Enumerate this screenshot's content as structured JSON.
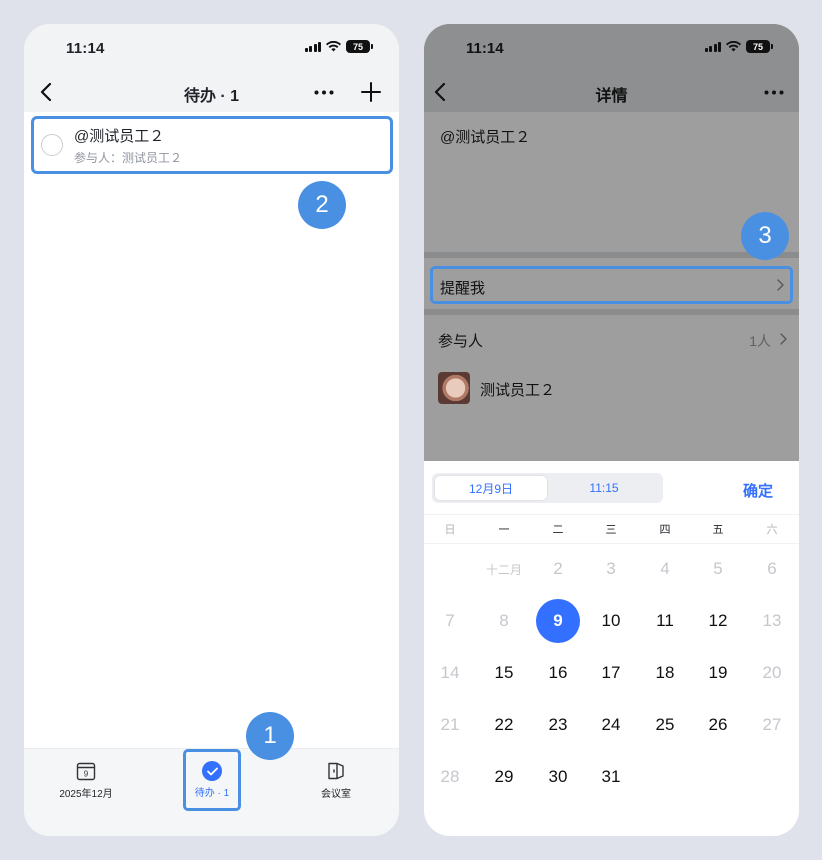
{
  "left": {
    "status": {
      "time": "11:14",
      "battery": "75"
    },
    "nav": {
      "title": "待办 · 1"
    },
    "todo": {
      "title": "@测试员工２",
      "participants": "参与人：测试员工２"
    },
    "tabs": [
      {
        "label": "2025年12月",
        "icon": "calendar-icon",
        "day": "9"
      },
      {
        "label": "待办 · 1",
        "icon": "check-circle-icon"
      },
      {
        "label": "会议室",
        "icon": "meeting-room-icon"
      }
    ],
    "badges": [
      "1",
      "2"
    ]
  },
  "right": {
    "status": {
      "time": "11:14",
      "battery": "75"
    },
    "nav": {
      "title": "详情"
    },
    "content_title": "@测试员工２",
    "remind_label": "提醒我",
    "participants_label": "参与人",
    "participants_count": "1人",
    "participant_name": "测试员工２",
    "badge": "3",
    "picker": {
      "date_tab": "12月9日",
      "time_tab": "11:15",
      "confirm": "确定",
      "weekdays": [
        "日",
        "一",
        "二",
        "三",
        "四",
        "五",
        "六"
      ],
      "rows": [
        [
          "",
          "十二月",
          "2",
          "3",
          "4",
          "5",
          "6"
        ],
        [
          "7",
          "8",
          "9",
          "10",
          "11",
          "12",
          "13"
        ],
        [
          "14",
          "15",
          "16",
          "17",
          "18",
          "19",
          "20"
        ],
        [
          "21",
          "22",
          "23",
          "24",
          "25",
          "26",
          "27"
        ],
        [
          "28",
          "29",
          "30",
          "31",
          "",
          "",
          ""
        ]
      ],
      "selected": "9"
    }
  },
  "colors": {
    "accent": "#3370ff",
    "highlight": "#4a90e2",
    "background": "#dfe2ea"
  }
}
